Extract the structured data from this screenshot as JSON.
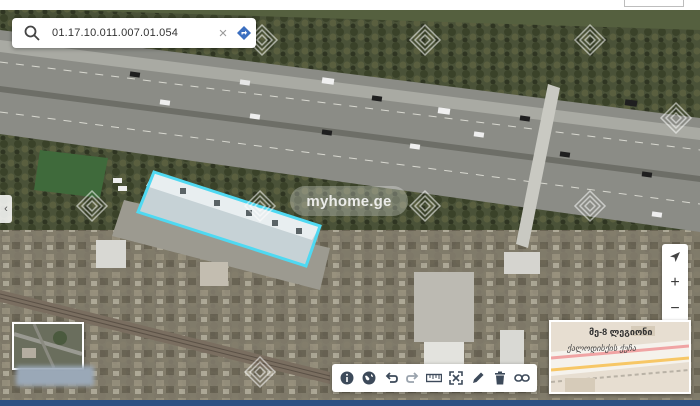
{
  "search": {
    "value": "01.17.10.011.007.01.054",
    "clear_label": "×"
  },
  "watermark": {
    "text": "myhome.ge"
  },
  "map_controls": {
    "locate_icon": "navigation-arrow-icon",
    "zoom_in": "+",
    "zoom_out": "−",
    "fullscreen_icon": "fullscreen-icon"
  },
  "toolbar": {
    "items": [
      "info-icon",
      "globe-icon",
      "undo-icon",
      "redo-icon",
      "ruler-icon",
      "expand-icon",
      "pencil-icon",
      "trash-icon",
      "link-icon"
    ]
  },
  "street_preview": {
    "label_top": "მე-8 ლეგიონი",
    "label_street": "ქალოდისქის ქუჩა"
  },
  "colors": {
    "parcel_outline": "#4fd9f2",
    "bottom_bar": "#2c4f82",
    "direction_icon": "#3b6fc0"
  }
}
